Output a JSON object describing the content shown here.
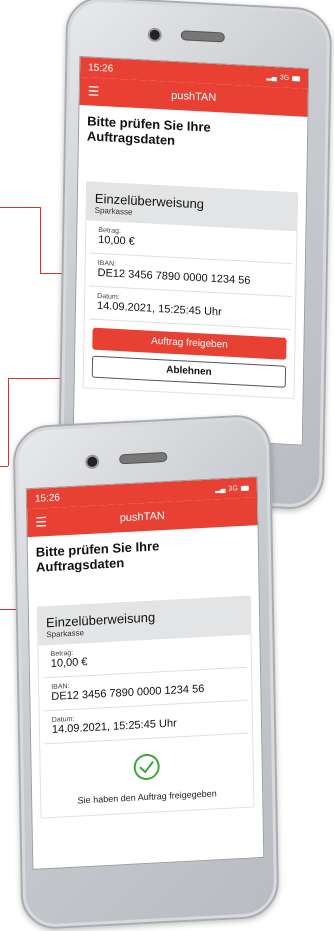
{
  "screen_top": {
    "status_time": "15:26",
    "network": "3G",
    "app_title": "pushTAN",
    "heading": "Bitte prüfen Sie Ihre Auftragsdaten",
    "card_title": "Einzelüberweisung",
    "card_sub": "Sparkasse",
    "fields": [
      {
        "label": "Betrag:",
        "value": "10,00 €"
      },
      {
        "label": "IBAN:",
        "value": "DE12 3456 7890 0000 1234 56"
      },
      {
        "label": "Datum:",
        "value": "14.09.2021, 15:25:45 Uhr"
      }
    ],
    "approve_label": "Auftrag freigeben",
    "reject_label": "Ablehnen"
  },
  "screen_bottom": {
    "status_time": "15:26",
    "network": "3G",
    "app_title": "pushTAN",
    "heading": "Bitte prüfen Sie Ihre Auftragsdaten",
    "card_title": "Einzelüberweisung",
    "card_sub": "Sparkasse",
    "fields": [
      {
        "label": "Betrag:",
        "value": "10,00 €"
      },
      {
        "label": "IBAN:",
        "value": "DE12 3456 7890 0000 1234 56"
      },
      {
        "label": "Datum:",
        "value": "14.09.2021, 15:25:45 Uhr"
      }
    ],
    "success_text": "Sie haben den Auftrag freigegeben"
  },
  "colors": {
    "accent": "#e84133",
    "success": "#3aa935"
  },
  "icons": [
    "menu-icon",
    "battery-icon",
    "signal-icon",
    "checkmark-circle-icon",
    "camera-icon",
    "speaker-icon"
  ]
}
